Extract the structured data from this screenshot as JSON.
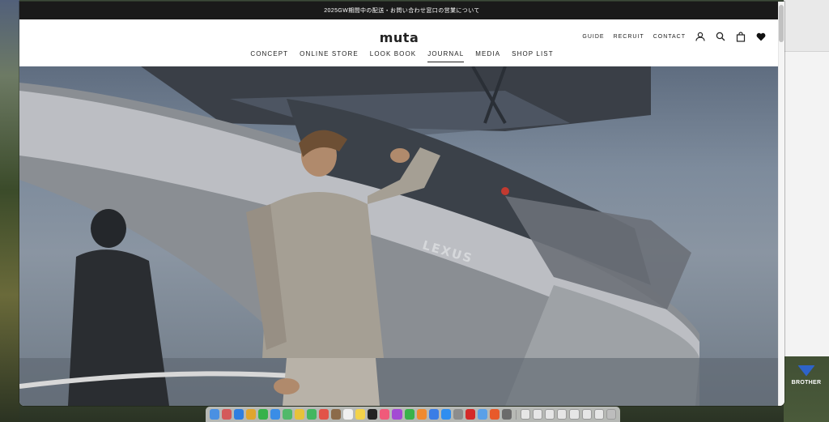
{
  "announcement": "2025GW期間中の配送・お問い合わせ窓口の営業について",
  "brand": {
    "logo_text": "muta"
  },
  "utility_links": [
    "GUIDE",
    "RECRUIT",
    "CONTACT"
  ],
  "utility_icons": [
    "account-icon",
    "search-icon",
    "cart-icon",
    "heart-icon"
  ],
  "nav": {
    "items": [
      "CONCEPT",
      "ONLINE STORE",
      "LOOK BOOK",
      "JOURNAL",
      "MEDIA",
      "SHOP LIST"
    ],
    "active": "JOURNAL"
  },
  "hero": {
    "boat_badge_text": "LEXUS"
  },
  "desktop": {
    "printer_label": "BROTHER"
  },
  "dock": {
    "apps": [
      "finder-icon",
      "launchpad-icon",
      "safari-icon",
      "chrome-icon",
      "messages-icon",
      "mail-icon",
      "maps-icon",
      "photos-icon",
      "facetime-icon",
      "calendar-icon",
      "contacts-icon",
      "reminders-icon",
      "notes-icon",
      "tv-icon",
      "music-icon",
      "podcasts-icon",
      "numbers-icon",
      "pages-icon",
      "keynote-icon",
      "appstore-icon",
      "settings-icon",
      "acrobat-icon",
      "preview-icon",
      "office-icon",
      "screenshot-icon"
    ],
    "recent": [
      "doc-icon",
      "window-icon",
      "window-icon",
      "window-icon",
      "window-icon",
      "window-icon",
      "window-icon",
      "trash-icon"
    ],
    "colors": [
      "#4a90e2",
      "#d45a5a",
      "#2f7ee0",
      "#e0a52f",
      "#36b24a",
      "#3a8de6",
      "#51b96a",
      "#e8c23a",
      "#44b660",
      "#e25448",
      "#8c6b4a",
      "#f0f0f0",
      "#f3d34a",
      "#222222",
      "#f05a7a",
      "#a34ad4",
      "#39b24a",
      "#f08a2f",
      "#3a7de6",
      "#2f8ef0",
      "#8d8d8d",
      "#d42a2a",
      "#5aa0e8",
      "#e85a2a",
      "#6b6b6b"
    ]
  }
}
